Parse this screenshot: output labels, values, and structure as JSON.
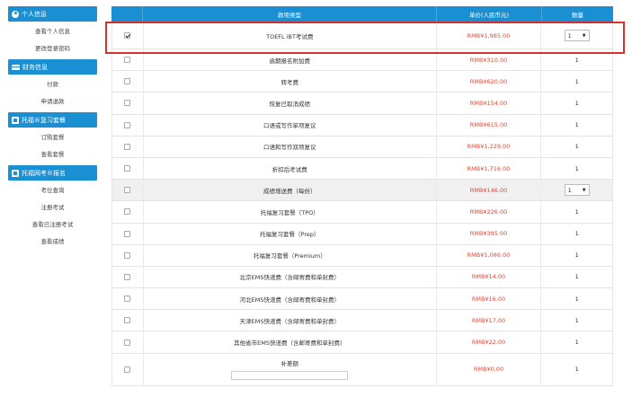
{
  "sidebar": {
    "groups": [
      {
        "title": "个人信息",
        "icon": "user-icon",
        "items": [
          "查看个人信息",
          "更改登录密码"
        ]
      },
      {
        "title": "财务信息",
        "icon": "card-icon",
        "items": [
          "付款",
          "申请退款"
        ]
      },
      {
        "title": "托福®复习套餐",
        "icon": "box-icon",
        "items": [
          "订购套餐",
          "查看套餐"
        ]
      },
      {
        "title": "托福网考®报名",
        "icon": "box-icon",
        "items": [
          "考位查询",
          "注册考试",
          "查看已注册考试",
          "查看成绩"
        ]
      }
    ]
  },
  "table": {
    "headers": {
      "item": "款项类型",
      "price": "单价(人民币元)",
      "qty": "数量"
    },
    "rows": [
      {
        "checked": true,
        "name": "TOEFL iBT考试费",
        "price": "RMB¥1,985.00",
        "qty": "1",
        "select": true
      },
      {
        "checked": false,
        "name": "逾期报名附加费",
        "price": "RMB¥310.00",
        "qty": "1"
      },
      {
        "checked": false,
        "name": "转考费",
        "price": "RMB¥620.00",
        "qty": "1"
      },
      {
        "checked": false,
        "name": "恢复已取消成绩",
        "price": "RMB¥154.00",
        "qty": "1"
      },
      {
        "checked": false,
        "name": "口语或写作单项复议",
        "price": "RMB¥615.00",
        "qty": "1"
      },
      {
        "checked": false,
        "name": "口语和写作双项复议",
        "price": "RMB¥1,229.00",
        "qty": "1"
      },
      {
        "checked": false,
        "name": "折扣后考试费",
        "price": "RMB¥1,716.00",
        "qty": "1"
      },
      {
        "checked": false,
        "name": "成绩增送费（每份）",
        "price": "RMB¥146.00",
        "qty": "1",
        "select": true,
        "shaded": true
      },
      {
        "checked": false,
        "name": "托福复习套餐（TPO）",
        "price": "RMB¥226.00",
        "qty": "1"
      },
      {
        "checked": false,
        "name": "托福复习套餐（Prep）",
        "price": "RMB¥395.00",
        "qty": "1"
      },
      {
        "checked": false,
        "name": "托福复习套餐（Premium）",
        "price": "RMB¥1,086.00",
        "qty": "1"
      },
      {
        "checked": false,
        "name": "北京EMS快递费（含邮寄费和单封费）",
        "price": "RMB¥14.00",
        "qty": "1"
      },
      {
        "checked": false,
        "name": "河北EMS快递费（含邮寄费和单封费）",
        "price": "RMB¥16.00",
        "qty": "1"
      },
      {
        "checked": false,
        "name": "天津EMS快递费（含邮寄费和单封费）",
        "price": "RMB¥17.00",
        "qty": "1"
      },
      {
        "checked": false,
        "name": "其他省市EMS快递费（含邮寄费和单封费）",
        "price": "RMB¥22.00",
        "qty": "1"
      },
      {
        "checked": false,
        "name": "补差额",
        "price": "RMB¥0.00",
        "qty": "1",
        "input": true
      }
    ]
  },
  "colors": {
    "accent": "#1a8fd1",
    "price": "#e04a3a",
    "highlight": "#d63030"
  }
}
